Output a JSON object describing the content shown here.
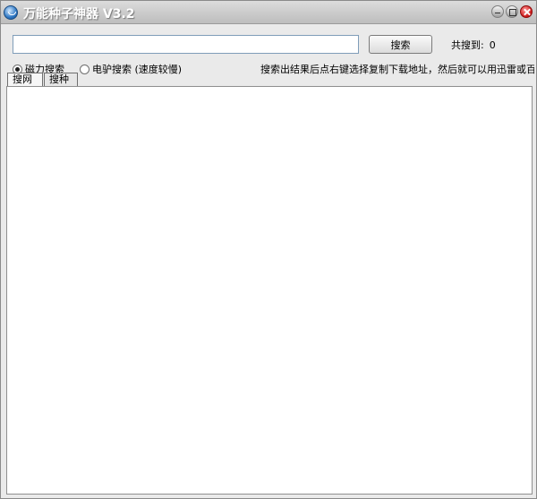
{
  "window": {
    "title": "万能种子神器 V3.2"
  },
  "search": {
    "input_value": "",
    "button_label": "搜索"
  },
  "result": {
    "label": "共搜到:",
    "count": "0"
  },
  "options": {
    "magnet": {
      "label": "磁力搜索",
      "checked": true
    },
    "edonkey": {
      "label": "电驴搜索 (速度较慢)",
      "checked": false
    }
  },
  "hint": "搜索出结果后点右键选择复制下载地址，然后就可以用迅雷或百度云",
  "tabs": [
    {
      "label": "搜网站"
    },
    {
      "label": "搜种子"
    }
  ],
  "icons": {
    "app": "app-icon",
    "minimize": "minimize-icon",
    "maximize": "maximize-icon",
    "close": "close-icon"
  }
}
